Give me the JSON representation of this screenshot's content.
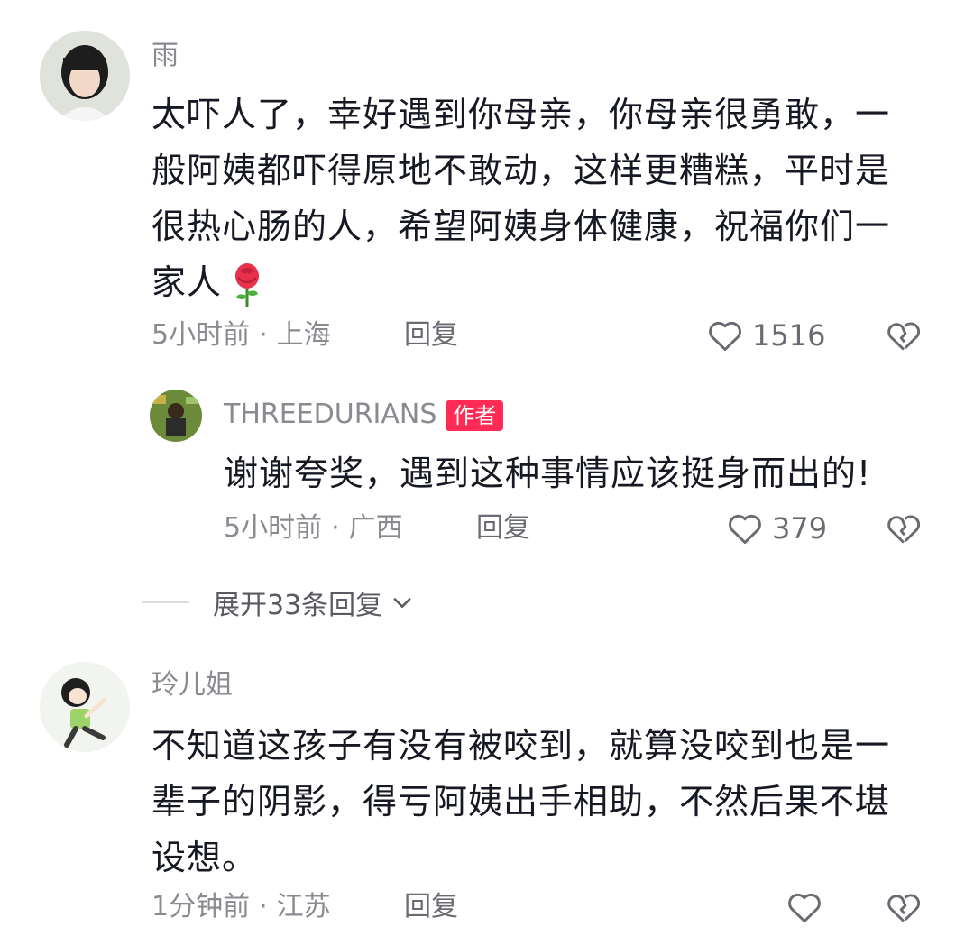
{
  "comments": [
    {
      "username": "雨",
      "text_lines": [
        "太吓人了，幸好遇到你母亲，你母亲很勇敢，一",
        "般阿姨都吓得原地不敢动，这样更糟糕，平时是",
        "很热心肠的人，希望阿姨身体健康，祝福你们一",
        "家人"
      ],
      "emoji": "rose",
      "time": "5小时前",
      "location": "上海",
      "reply_label": "回复",
      "likes": "1516"
    },
    {
      "username": "玲儿姐",
      "text_lines": [
        "不知道这孩子有没有被咬到，就算没咬到也是一",
        "辈子的阴影，得亏阿姨出手相助，不然后果不堪",
        "设想。"
      ],
      "time": "1分钟前",
      "location": "江苏",
      "reply_label": "回复",
      "likes": ""
    }
  ],
  "reply": {
    "username": "THREEDURIANS",
    "badge": "作者",
    "text": "谢谢夸奖，遇到这种事情应该挺身而出的!",
    "time": "5小时前",
    "location": "广西",
    "reply_label": "回复",
    "likes": "379"
  },
  "expand_label": "展开33条回复",
  "icons": {
    "like": "heart-outline-icon",
    "dislike": "broken-heart-icon",
    "expand": "chevron-down-icon"
  },
  "colors": {
    "badge": "#fe2c55",
    "text": "#161823",
    "muted": "#8a8b91"
  }
}
